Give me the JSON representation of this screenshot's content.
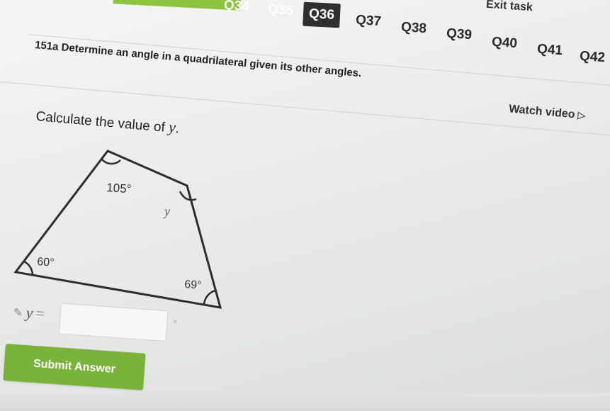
{
  "nav": {
    "tabs": [
      "Q34",
      "Q35",
      "Q36",
      "Q37",
      "Q38",
      "Q39",
      "Q40",
      "Q41",
      "Q42"
    ],
    "active": "Q36",
    "exit_label": "Exit task"
  },
  "question": {
    "title": "151a Determine an angle in a quadrilateral given its other angles.",
    "watch_label": "Watch video",
    "prompt_text": "Calculate the value of ",
    "prompt_var": "y",
    "prompt_end": "."
  },
  "diagram": {
    "angles": [
      {
        "label": "105°"
      },
      {
        "label": "60°"
      },
      {
        "label": "69°"
      },
      {
        "label": "y"
      }
    ]
  },
  "answer": {
    "var_label": "y",
    "equals": "=",
    "value": "",
    "unit": "°",
    "submit_label": "Submit Answer"
  }
}
